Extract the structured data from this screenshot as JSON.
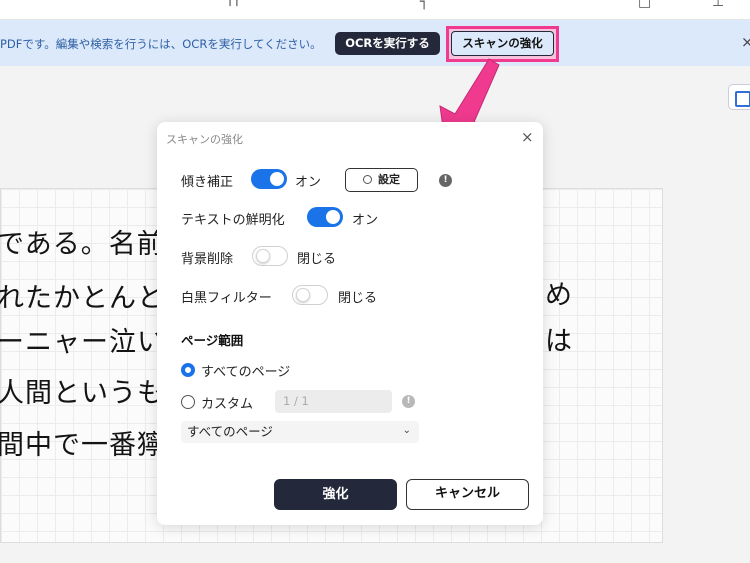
{
  "ocr_bar": {
    "message": "PDFです。編集や検索を行うには、OCRを実行してください。",
    "run_ocr_label": "OCRを実行する",
    "enhance_scan_label": "スキャンの強化",
    "close_glyph": "×"
  },
  "document": {
    "handwriting_lines": [
      "である。名前は",
      "れたかとんと見",
      "ーニャー泣いて",
      "人間というもの",
      "間中で一番獰"
    ],
    "handwriting_right": [
      "め",
      "は"
    ]
  },
  "dialog": {
    "title": "スキャンの強化",
    "close_glyph": "×",
    "deskew": {
      "label": "傾き補正",
      "state": "オン",
      "on": true,
      "settings_label": "設定"
    },
    "sharpen_text": {
      "label": "テキストの鮮明化",
      "state": "オン",
      "on": true
    },
    "remove_background": {
      "label": "背景削除",
      "state": "閉じる",
      "on": false
    },
    "bw_filter": {
      "label": "白黒フィルター",
      "state": "閉じる",
      "on": false
    },
    "page_range": {
      "title": "ページ範囲",
      "all_pages_label": "すべてのページ",
      "custom_label": "カスタム",
      "custom_placeholder": "1 / 1",
      "select_value": "すべてのページ"
    },
    "enhance_button": "強化",
    "cancel_button": "キャンセル"
  },
  "colors": {
    "accent": "#1a73e8",
    "highlight": "#ef3a8f",
    "dark_button": "#23293a",
    "info_bar": "#dbe9fb"
  },
  "icons": [
    "settings-hex-icon",
    "info-icon",
    "close-icon",
    "chevron-down-icon",
    "view-icon",
    "callout-arrow-icon"
  ]
}
